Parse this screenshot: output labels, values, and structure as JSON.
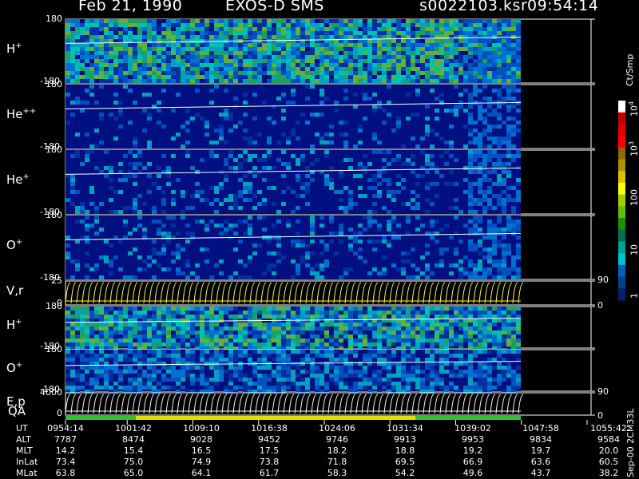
{
  "header": {
    "date": "Feb 21, 1990",
    "instrument": "EXOS-D SMS",
    "file": "s0022103.ksr",
    "time": "09:54:14"
  },
  "panels": [
    {
      "label": "H",
      "sup": "+",
      "ymax": "180",
      "ymin": "-180"
    },
    {
      "label": "He",
      "sup": "++",
      "ymax": "180",
      "ymin": "-180"
    },
    {
      "label": "He",
      "sup": "+",
      "ymax": "180",
      "ymin": "-180"
    },
    {
      "label": "O",
      "sup": "+",
      "ymax": "180",
      "ymin": "-180"
    },
    {
      "label": "V,r",
      "sup": "",
      "ymax": "25",
      "ymin": "0",
      "right_max": "90",
      "right_min": "0"
    },
    {
      "label": "H",
      "sup": "+",
      "ymax": "180",
      "ymin": "-180"
    },
    {
      "label": "O",
      "sup": "+",
      "ymax": "180",
      "ymin": "-180"
    },
    {
      "label": "E,p",
      "sup": "",
      "ymax": "4000",
      "ymin": "0",
      "right_max": "90",
      "right_min": "0"
    }
  ],
  "qa_label": "QA",
  "colorbar": {
    "unit": "Ct/Smp",
    "ticks": [
      {
        "base": "10",
        "exp": "4"
      },
      {
        "base": "10",
        "exp": "3"
      },
      {
        "base": "100",
        "exp": ""
      },
      {
        "base": "10",
        "exp": ""
      },
      {
        "base": "1",
        "exp": ""
      }
    ],
    "colors": [
      "#ffffff",
      "#c00000",
      "#e00000",
      "#ff0000",
      "#8b6a00",
      "#b09000",
      "#e0c000",
      "#ffff00",
      "#a0d000",
      "#60c000",
      "#209000",
      "#007050",
      "#00a0a0",
      "#00c0d0",
      "#0060c0",
      "#004090",
      "#002070"
    ]
  },
  "table": {
    "rows": [
      {
        "label": "UT",
        "values": [
          "0954:14",
          "1001:42",
          "1009:10",
          "1016:38",
          "1024:06",
          "1031:34",
          "1039:02",
          "1047:58",
          "1055:42"
        ]
      },
      {
        "label": "ALT",
        "values": [
          "7787",
          "8474",
          "9028",
          "9452",
          "9746",
          "9913",
          "9953",
          "9834",
          "9584"
        ]
      },
      {
        "label": "MLT",
        "values": [
          "14.2",
          "15.4",
          "16.5",
          "17.5",
          "18.2",
          "18.8",
          "19.2",
          "19.7",
          "20.0"
        ]
      },
      {
        "label": "InLat",
        "values": [
          "73.4",
          "75.0",
          "74.9",
          "73.8",
          "71.8",
          "69.5",
          "66.9",
          "63.6",
          "60.5"
        ]
      },
      {
        "label": "MLat",
        "values": [
          "63.8",
          "65.0",
          "64.1",
          "61.7",
          "58.3",
          "54.2",
          "49.6",
          "43.7",
          "38.2"
        ]
      }
    ]
  },
  "footer_code": "Sep-00 2CM33L",
  "chart_data": {
    "type": "heatmap",
    "title": "Feb 21, 1990   EXOS-D SMS",
    "xlabel": "UT",
    "x_ticks": [
      "0954:14",
      "1001:42",
      "1009:10",
      "1016:38",
      "1024:06",
      "1031:34",
      "1039:02",
      "1047:58",
      "1055:42"
    ],
    "series": [
      {
        "name": "H+",
        "ylim": [
          -180,
          180
        ]
      },
      {
        "name": "He++",
        "ylim": [
          -180,
          180
        ]
      },
      {
        "name": "He+",
        "ylim": [
          -180,
          180
        ]
      },
      {
        "name": "O+",
        "ylim": [
          -180,
          180
        ]
      },
      {
        "name": "V,r",
        "ylim": [
          0,
          25
        ]
      },
      {
        "name": "H+",
        "ylim": [
          -180,
          180
        ]
      },
      {
        "name": "O+",
        "ylim": [
          -180,
          180
        ]
      },
      {
        "name": "E,p",
        "ylim": [
          0,
          4000
        ]
      }
    ],
    "colorbar_range": [
      1,
      10000
    ],
    "colorbar_scale": "log",
    "colorbar_unit": "Ct/Smp"
  }
}
